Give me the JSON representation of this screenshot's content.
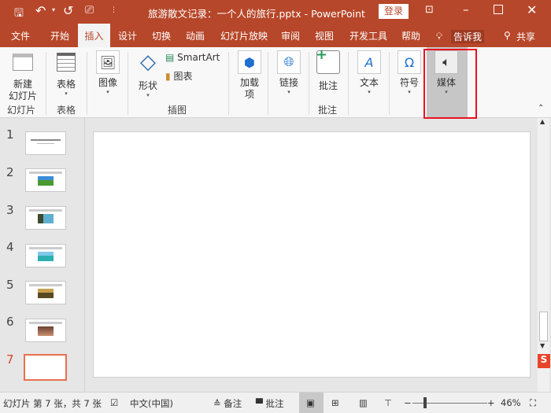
{
  "titlebar": {
    "title": "旅游散文记录：一个人的旅行.pptx  -  PowerPoint",
    "login": "登录",
    "icons": [
      "save-icon",
      "undo-icon",
      "redo-icon",
      "presenter-icon",
      "customize-icon",
      "ribbon-display-icon",
      "minimize-icon",
      "maximize-icon",
      "close-icon"
    ]
  },
  "tabs": [
    {
      "label": "文件"
    },
    {
      "label": "开始"
    },
    {
      "label": "插入",
      "active": true
    },
    {
      "label": "设计"
    },
    {
      "label": "切换"
    },
    {
      "label": "动画"
    },
    {
      "label": "幻灯片放映"
    },
    {
      "label": "审阅"
    },
    {
      "label": "视图"
    },
    {
      "label": "开发工具"
    },
    {
      "label": "帮助"
    }
  ],
  "tellme": "告诉我",
  "share": "共享",
  "ribbon": {
    "new_slide": "新建\n幻灯片",
    "table": "表格",
    "image": "图像",
    "shape": "形状",
    "smartart": "SmartArt",
    "chart": "图表",
    "addins": "加载\n项",
    "link": "链接",
    "comment": "批注",
    "text": "文本",
    "symbol": "符号",
    "media": "媒体",
    "groups": {
      "slides": "幻灯片",
      "tables": "表格",
      "illustrations": "插图",
      "comments": "批注"
    }
  },
  "thumbnails": [
    {
      "num": "1"
    },
    {
      "num": "2"
    },
    {
      "num": "3"
    },
    {
      "num": "4"
    },
    {
      "num": "5"
    },
    {
      "num": "6"
    },
    {
      "num": "7",
      "selected": true
    }
  ],
  "status": {
    "slide_info": "幻灯片 第 7 张，共 7 张",
    "language": "中文(中国)",
    "notes": "备注",
    "comments": "批注",
    "zoom": "46%",
    "zoom_level": 46
  },
  "colors": {
    "accent": "#b7472a",
    "highlight": "#e81123"
  }
}
